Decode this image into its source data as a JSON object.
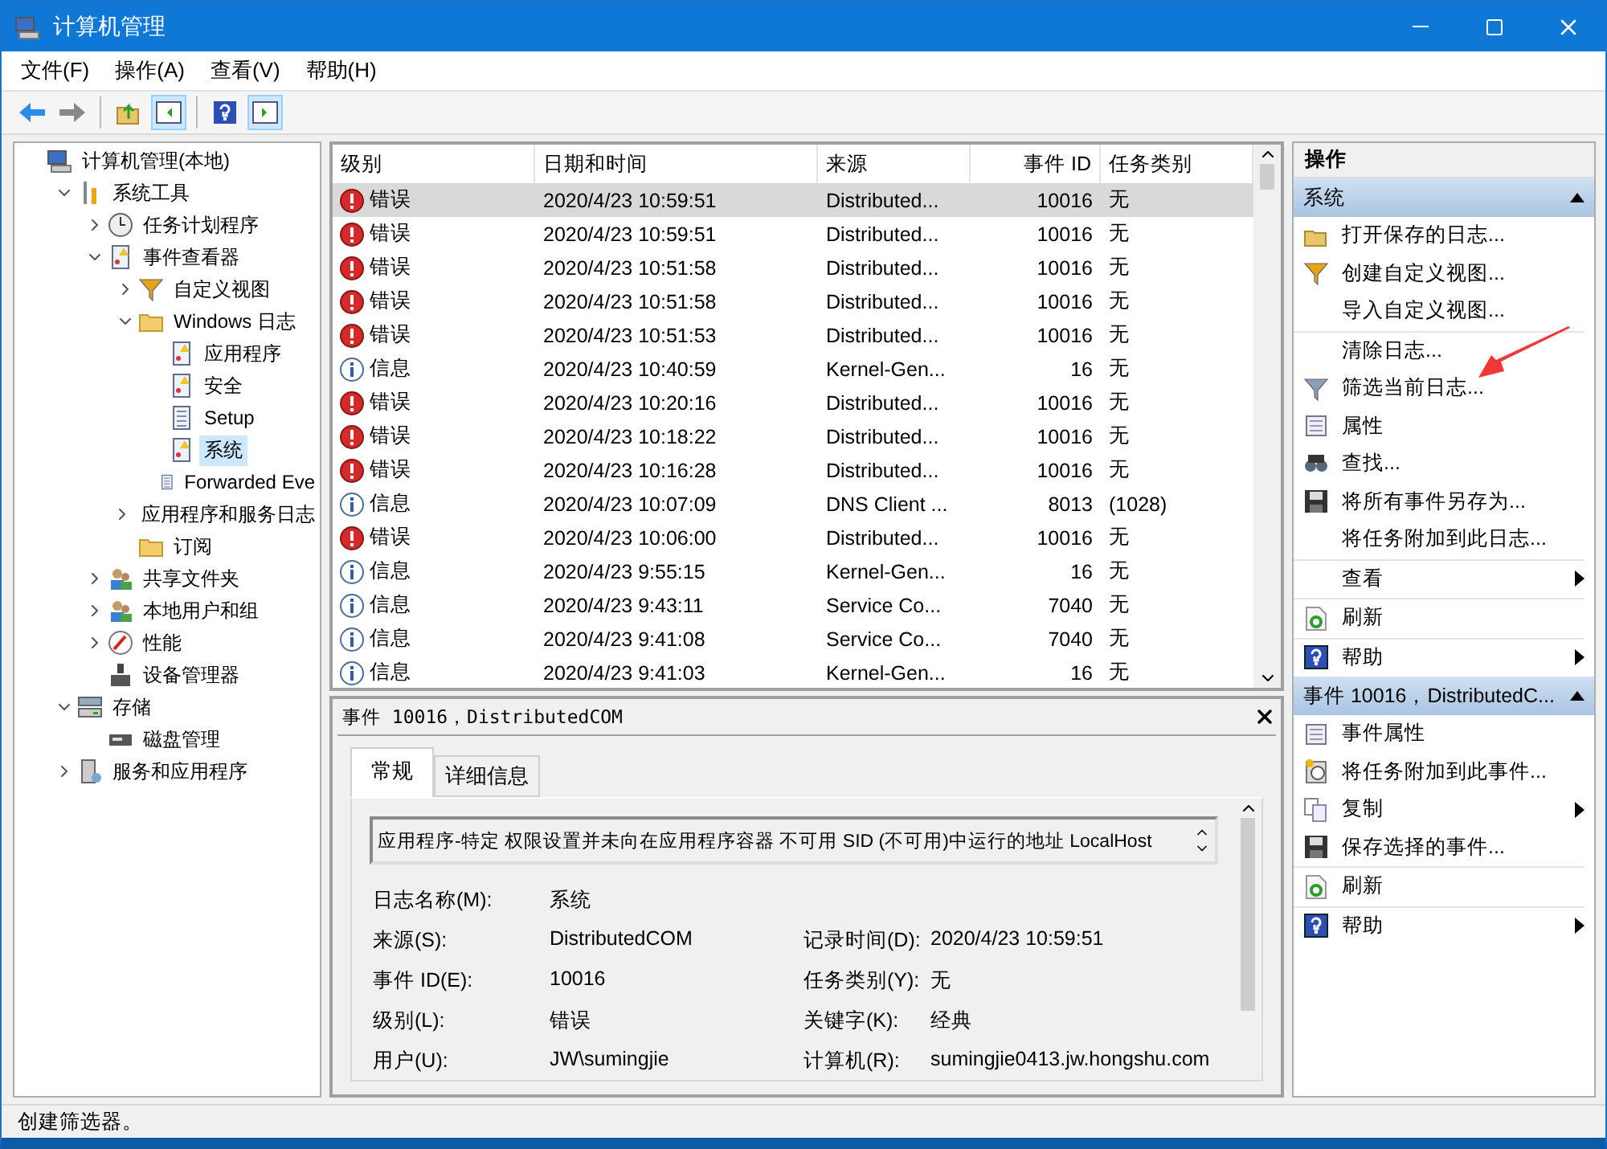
{
  "window": {
    "title": "计算机管理"
  },
  "menu": [
    "文件(F)",
    "操作(A)",
    "查看(V)",
    "帮助(H)"
  ],
  "toolbar": [
    {
      "pressed": false
    },
    {
      "pressed": false
    },
    {
      "pressed": false
    },
    {
      "pressed": true
    },
    {
      "pressed": false
    },
    {
      "pressed": true
    }
  ],
  "tree": [
    {
      "label": "计算机管理(本地)",
      "selected": false,
      "children": [
        {
          "label": "系统工具",
          "selected": false,
          "expanded": true,
          "children": [
            {
              "label": "任务计划程序",
              "selected": false,
              "expanded": false
            },
            {
              "label": "事件查看器",
              "selected": false,
              "expanded": true,
              "children": [
                {
                  "label": "自定义视图",
                  "selected": false,
                  "expanded": false
                },
                {
                  "label": "Windows 日志",
                  "selected": false,
                  "expanded": true,
                  "children": [
                    {
                      "label": "应用程序",
                      "selected": false
                    },
                    {
                      "label": "安全",
                      "selected": false
                    },
                    {
                      "label": "Setup",
                      "selected": false
                    },
                    {
                      "label": "系统",
                      "selected": true
                    },
                    {
                      "label": "Forwarded Eve",
                      "selected": false
                    }
                  ]
                },
                {
                  "label": "应用程序和服务日志",
                  "selected": false,
                  "expanded": false
                },
                {
                  "label": "订阅",
                  "selected": false
                }
              ]
            },
            {
              "label": "共享文件夹",
              "selected": false,
              "expanded": false
            },
            {
              "label": "本地用户和组",
              "selected": false,
              "expanded": false
            },
            {
              "label": "性能",
              "selected": false,
              "expanded": false
            },
            {
              "label": "设备管理器",
              "selected": false
            }
          ]
        },
        {
          "label": "存储",
          "selected": false,
          "expanded": true,
          "children": [
            {
              "label": "磁盘管理",
              "selected": false
            }
          ]
        },
        {
          "label": "服务和应用程序",
          "selected": false,
          "expanded": false
        }
      ]
    }
  ],
  "table": {
    "columns": [
      "级别",
      "日期和时间",
      "来源",
      "事件 ID",
      "任务类别"
    ],
    "rows": [
      {
        "kind": "error",
        "selected": true,
        "cells": [
          "错误",
          "2020/4/23 10:59:51",
          "Distributed...",
          "10016",
          "无"
        ]
      },
      {
        "kind": "error",
        "selected": false,
        "cells": [
          "错误",
          "2020/4/23 10:59:51",
          "Distributed...",
          "10016",
          "无"
        ]
      },
      {
        "kind": "error",
        "selected": false,
        "cells": [
          "错误",
          "2020/4/23 10:51:58",
          "Distributed...",
          "10016",
          "无"
        ]
      },
      {
        "kind": "error",
        "selected": false,
        "cells": [
          "错误",
          "2020/4/23 10:51:58",
          "Distributed...",
          "10016",
          "无"
        ]
      },
      {
        "kind": "error",
        "selected": false,
        "cells": [
          "错误",
          "2020/4/23 10:51:53",
          "Distributed...",
          "10016",
          "无"
        ]
      },
      {
        "kind": "info",
        "selected": false,
        "cells": [
          "信息",
          "2020/4/23 10:40:59",
          "Kernel-Gen...",
          "16",
          "无"
        ]
      },
      {
        "kind": "error",
        "selected": false,
        "cells": [
          "错误",
          "2020/4/23 10:20:16",
          "Distributed...",
          "10016",
          "无"
        ]
      },
      {
        "kind": "error",
        "selected": false,
        "cells": [
          "错误",
          "2020/4/23 10:18:22",
          "Distributed...",
          "10016",
          "无"
        ]
      },
      {
        "kind": "error",
        "selected": false,
        "cells": [
          "错误",
          "2020/4/23 10:16:28",
          "Distributed...",
          "10016",
          "无"
        ]
      },
      {
        "kind": "info",
        "selected": false,
        "cells": [
          "信息",
          "2020/4/23 10:07:09",
          "DNS Client ...",
          "8013",
          "(1028)"
        ]
      },
      {
        "kind": "error",
        "selected": false,
        "cells": [
          "错误",
          "2020/4/23 10:06:00",
          "Distributed...",
          "10016",
          "无"
        ]
      },
      {
        "kind": "info",
        "selected": false,
        "cells": [
          "信息",
          "2020/4/23 9:55:15",
          "Kernel-Gen...",
          "16",
          "无"
        ]
      },
      {
        "kind": "info",
        "selected": false,
        "cells": [
          "信息",
          "2020/4/23 9:43:11",
          "Service Co...",
          "7040",
          "无"
        ]
      },
      {
        "kind": "info",
        "selected": false,
        "cells": [
          "信息",
          "2020/4/23 9:41:08",
          "Service Co...",
          "7040",
          "无"
        ]
      },
      {
        "kind": "info",
        "selected": false,
        "cells": [
          "信息",
          "2020/4/23 9:41:03",
          "Kernel-Gen...",
          "16",
          "无"
        ]
      }
    ]
  },
  "detail": {
    "title": "事件 10016，DistributedCOM",
    "tabs": [
      {
        "label": "常规",
        "selected": true
      },
      {
        "label": "详细信息",
        "selected": false
      }
    ],
    "description": "应用程序-特定 权限设置并未向在应用程序容器 不可用 SID (不可用)中运行的地址 LocalHost",
    "fields": [
      [
        {
          "label": "日志名称(M):",
          "value": "系统"
        }
      ],
      [
        {
          "label": "来源(S):",
          "value": "DistributedCOM"
        },
        {
          "label": "记录时间(D):",
          "value": "2020/4/23 10:59:51"
        }
      ],
      [
        {
          "label": "事件 ID(E):",
          "value": "10016"
        },
        {
          "label": "任务类别(Y):",
          "value": "无"
        }
      ],
      [
        {
          "label": "级别(L):",
          "value": "错误"
        },
        {
          "label": "关键字(K):",
          "value": "经典"
        }
      ],
      [
        {
          "label": "用户(U):",
          "value": "JW\\sumingjie"
        },
        {
          "label": "计算机(R):",
          "value": "sumingjie0413.jw.hongshu.com"
        }
      ]
    ]
  },
  "actions": {
    "title": "操作",
    "sections": [
      {
        "title": "系统",
        "expanded": true,
        "items": [
          {
            "label": "打开保存的日志...",
            "submenu": false,
            "separator_after": false
          },
          {
            "label": "创建自定义视图...",
            "submenu": false,
            "separator_after": false
          },
          {
            "label": "导入自定义视图...",
            "submenu": false,
            "separator_after": true
          },
          {
            "label": "清除日志...",
            "submenu": false,
            "separator_after": false
          },
          {
            "label": "筛选当前日志...",
            "submenu": false,
            "separator_after": false
          },
          {
            "label": "属性",
            "submenu": false,
            "separator_after": false
          },
          {
            "label": "查找...",
            "submenu": false,
            "separator_after": false
          },
          {
            "label": "将所有事件另存为...",
            "submenu": false,
            "separator_after": false
          },
          {
            "label": "将任务附加到此日志...",
            "submenu": false,
            "separator_after": true
          },
          {
            "label": "查看",
            "submenu": true,
            "separator_after": true
          },
          {
            "label": "刷新",
            "submenu": false,
            "separator_after": true
          },
          {
            "label": "帮助",
            "submenu": true,
            "separator_after": false
          }
        ]
      },
      {
        "title": "事件 10016，DistributedC...",
        "expanded": true,
        "items": [
          {
            "label": "事件属性",
            "submenu": false,
            "separator_after": false
          },
          {
            "label": "将任务附加到此事件...",
            "submenu": false,
            "separator_after": false
          },
          {
            "label": "复制",
            "submenu": true,
            "separator_after": false
          },
          {
            "label": "保存选择的事件...",
            "submenu": false,
            "separator_after": true
          },
          {
            "label": "刷新",
            "submenu": false,
            "separator_after": true
          },
          {
            "label": "帮助",
            "submenu": true,
            "separator_after": false
          }
        ]
      }
    ]
  },
  "status_bar": "创建筛选器。"
}
